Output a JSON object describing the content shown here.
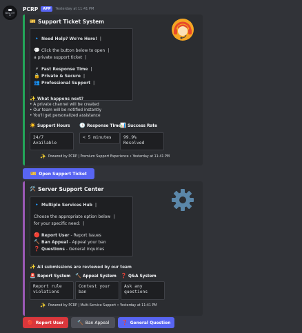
{
  "message": {
    "username": "PCRP",
    "badge": "APP",
    "timestamp": "Yesterday at 11:41 PM",
    "avatar_text": "PRIMA CITY RP"
  },
  "embed1": {
    "title": "Support Ticket System",
    "title_icon": "ticket-icon",
    "thumbnail": "support-agent-headset-icon",
    "code_lines": [
      {
        "icon": "diamond-icon",
        "text": "Need Help? We're Here!",
        "bold": true
      },
      {
        "icon": "speech-bubble-icon",
        "text": "Click the button below to open",
        "bold": false
      },
      {
        "icon": "",
        "text": "a private support ticket",
        "bold": false
      },
      {
        "icon": "lightning-icon",
        "text": "Fast Response Time",
        "bold": true
      },
      {
        "icon": "lock-icon",
        "text": "Private & Secure",
        "bold": true
      },
      {
        "icon": "people-icon",
        "text": "Professional Support",
        "bold": true
      }
    ],
    "next_title": "What happens next?",
    "next_items": [
      "• A private channel will be created",
      "• Our team will be notified instantly",
      "• You'll get personalized assistance"
    ],
    "fields": [
      {
        "icon": "sun-icon",
        "name": "Support Hours",
        "value_lines": [
          "24/7",
          "Available"
        ]
      },
      {
        "icon": "clock-icon",
        "name": "Response Time",
        "value_lines": [
          "< 5 minutes"
        ]
      },
      {
        "icon": "bar-chart-icon",
        "name": "Success Rate",
        "value_lines": [
          "99.9%",
          "Resolved"
        ]
      }
    ],
    "footer": "Powered by PCRP | Premium Support Experience • Yesterday at 11:41 PM",
    "accent": "#23a559"
  },
  "button1": {
    "label": "Open Support Ticket",
    "icon": "ticket-icon"
  },
  "embed2": {
    "title": "Server Support Center",
    "title_icon": "tools-icon",
    "thumbnail": "gear-icon",
    "code_lines": [
      {
        "icon": "diamond-icon",
        "text": "Multiple Services Hub",
        "bold": true,
        "desc": ""
      },
      {
        "icon": "",
        "text": "Choose the appropriate option below",
        "bold": false,
        "desc": ""
      },
      {
        "icon": "",
        "text": "for your specific need:",
        "bold": false,
        "desc": ""
      },
      {
        "icon": "red-circle-icon",
        "text": "Report User",
        "bold": true,
        "desc": " - Report issues"
      },
      {
        "icon": "hammer-icon",
        "text": "Ban Appeal",
        "bold": true,
        "desc": " - Appeal your ban"
      },
      {
        "icon": "question-icon",
        "text": "Questions",
        "bold": true,
        "desc": " - General inquiries"
      }
    ],
    "review_note": "All submissions are reviewed by our team",
    "fields": [
      {
        "icon": "alarm-icon",
        "name": "Report System",
        "value_lines": [
          "Report rule",
          "violations"
        ]
      },
      {
        "icon": "hammer-icon",
        "name": "Appeal System",
        "value_lines": [
          "Contest your",
          "ban"
        ]
      },
      {
        "icon": "question-icon",
        "name": "Q&A System",
        "value_lines": [
          "Ask any",
          "questions"
        ]
      }
    ],
    "footer": "Powered by PCRP | Multi-Service Support • Yesterday at 11:41 PM",
    "accent": "#9b59b6"
  },
  "buttons2": [
    {
      "label": "Report User",
      "icon": "red-circle-icon",
      "style": "danger"
    },
    {
      "label": "Ban Appeal",
      "icon": "hammer-icon",
      "style": "secondary"
    },
    {
      "label": "General Question",
      "icon": "question-icon",
      "style": "primary"
    }
  ]
}
